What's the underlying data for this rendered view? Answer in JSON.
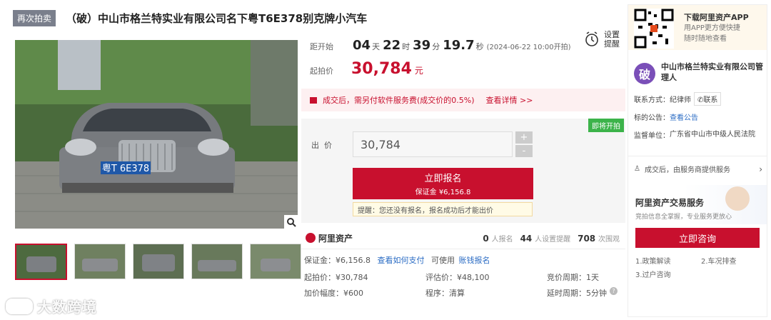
{
  "header": {
    "tag": "再次拍卖",
    "title": "（破）中山市格兰特实业有限公司名下粤T6E378别克牌小汽车"
  },
  "countdown": {
    "label": "距开始",
    "days": "04",
    "days_unit": "天",
    "hours": "22",
    "hours_unit": "时",
    "minutes": "39",
    "minutes_unit": "分",
    "seconds": "19.7",
    "seconds_unit": "秒",
    "start_note": "(2024-06-22 10:00开拍)"
  },
  "reminder": {
    "line1": "设置",
    "line2": "提醒"
  },
  "start_price": {
    "label": "起拍价",
    "value": "30,784",
    "unit": "元"
  },
  "service_notice": {
    "text": "成交后，需另付软件服务费(成交价的0.5%)",
    "link": "查看详情 >>"
  },
  "status_ribbon": "即将开拍",
  "bid": {
    "label": "出  价",
    "value": "30,784",
    "plus": "+",
    "minus": "-",
    "apply_button": "立即报名",
    "deposit_line": "保证金 ¥6,156.8",
    "tip": "提醒：您还没有报名，报名成功后才能出价"
  },
  "brand": "阿里资产",
  "stats": {
    "signups": "0",
    "signups_label": "人报名",
    "reminders": "44",
    "reminders_label": "人设置提醒",
    "views": "708",
    "views_label": "次围观"
  },
  "details": {
    "deposit": "保证金：¥6,156.8",
    "deposit_link": "查看如何支付",
    "can_use": "可使用",
    "credit_link": "账钱报名",
    "start_price": "起拍价：¥30,784",
    "appraisal": "评估价：¥48,100",
    "cycle": "竞价周期：1天",
    "increment": "加价幅度：¥600",
    "procedure": "程序：清算",
    "delay": "延时周期：5分钟"
  },
  "sidebar": {
    "app_title": "下载阿里资产APP",
    "app_line1": "用APP更方便快捷",
    "app_line2": "随时随地查看",
    "avatar_char": "破",
    "org_name": "中山市格兰特实业有限公司管理人",
    "contact_label": "联系方式：",
    "contact_name": "纪律师",
    "contact_button": "联系",
    "notice_label": "标的公告：",
    "notice_link": "查看公告",
    "supervisor_label": "监督单位：",
    "supervisor": "广东省中山市中级人民法院",
    "service_provider": "成交后，由服务商提供服务",
    "service_title": "阿里资产交易服务",
    "service_sub": "竞拍信息全掌握，专业服务更放心",
    "consult_button": "立即咨询",
    "items": [
      "1.政策解读",
      "2.车况排查",
      "3.过户咨询"
    ]
  },
  "watermark": "大数跨境",
  "colors": {
    "accent": "#c8102e",
    "link": "#2b6cc4",
    "green": "#3cb34a"
  }
}
